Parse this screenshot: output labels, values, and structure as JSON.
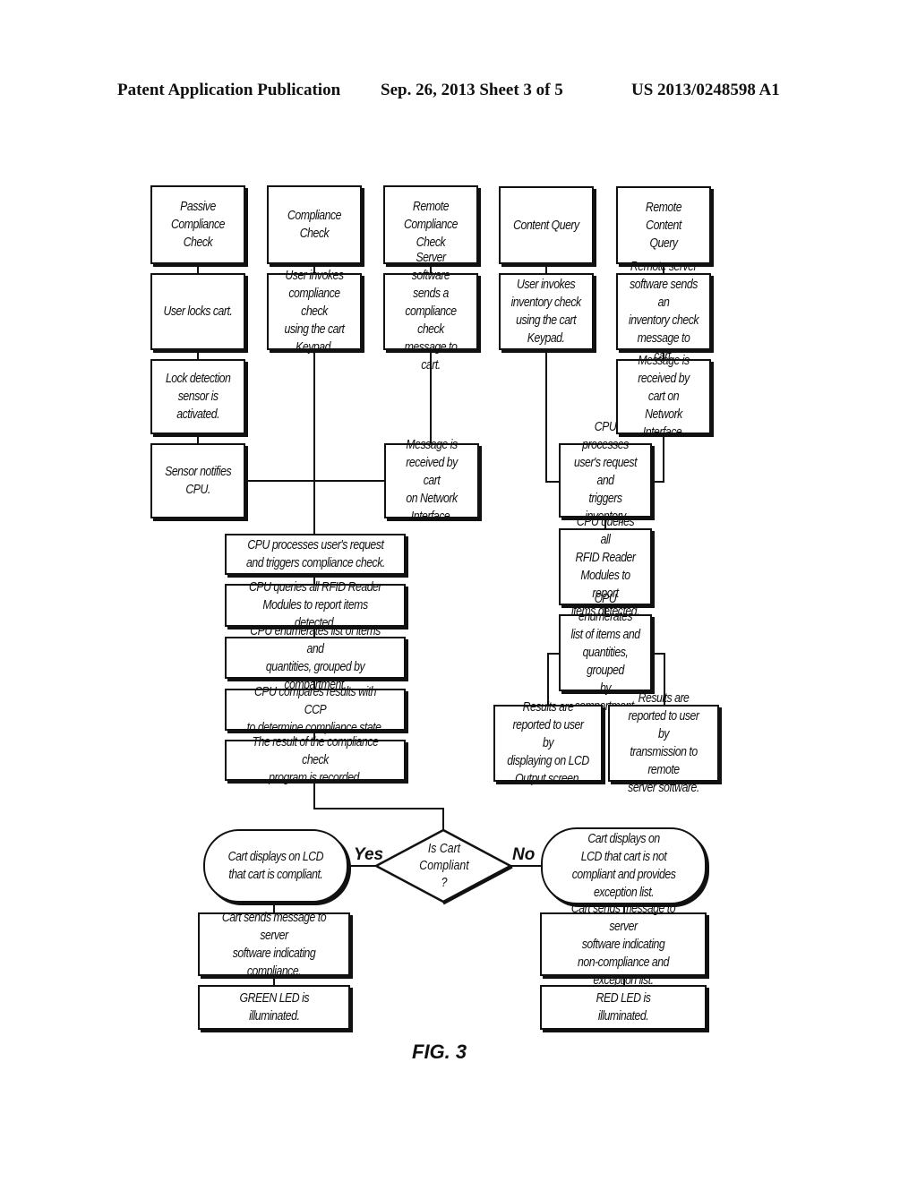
{
  "header": {
    "left": "Patent Application Publication",
    "middle": "Sep. 26, 2013   Sheet 3 of 5",
    "right": "US 2013/0248598 A1"
  },
  "figure_label": "FIG. 3",
  "columns": {
    "passive": {
      "title": "Passive\nCompliance Check",
      "steps": [
        "User locks cart.",
        "Lock detection\nsensor is\nactivated.",
        "Sensor notifies\nCPU."
      ]
    },
    "compliance": {
      "title": "Compliance Check",
      "steps": [
        "User invokes\ncompliance check\nusing the cart\nKeypad."
      ]
    },
    "remote_compliance": {
      "title": "Remote\nCompliance Check",
      "steps": [
        "Server software\nsends a\ncompliance check\nmessage to cart.",
        "Message is\nreceived by cart\non Network\nInterface."
      ]
    },
    "content_query": {
      "title": "Content Query",
      "steps": [
        "User invokes\ninventory check\nusing the cart\nKeypad."
      ]
    },
    "remote_content": {
      "title": "Remote Content\nQuery",
      "steps": [
        "Remote server\nsoftware sends an\ninventory check\nmessage to cart.",
        "Message is\nreceived by cart on\nNetwork Interface."
      ]
    }
  },
  "compliance_flow": [
    "CPU processes user's request\nand triggers compliance check.",
    "CPU queries all RFID Reader\nModules to report items detected.",
    "CPU enumerates list of items and\nquantities, grouped by compartment.",
    "CPU compares results with CCP\nto determine compliance state.",
    "The result of the compliance check\nprogram is recorded."
  ],
  "inventory_flow": [
    "CPU processes\nuser's request and\ntriggers inventory\ncheck.",
    "CPU queries all\nRFID Reader\nModules to report\nitems detected.",
    "CPU enumerates\nlist of items and\nquantities, grouped\nby compartment."
  ],
  "inventory_results": [
    "Results are\nreported to user by\ndisplaying on LCD\nOutput screen.",
    "Results are\nreported to user by\ntransmission to remote\nserver software."
  ],
  "decision": {
    "question": "Is Cart\nCompliant\n?",
    "yes_label": "Yes",
    "no_label": "No"
  },
  "yes_branch": [
    "Cart displays on LCD\nthat cart is compliant.",
    "Cart sends message to server\nsoftware indicating compliance.",
    "GREEN LED is\nilluminated."
  ],
  "no_branch": [
    "Cart displays on\nLCD that cart is not\ncompliant and provides\nexception list.",
    "Cart sends message to server\nsoftware indicating\nnon-compliance and exception list.",
    "RED LED is\nilluminated."
  ]
}
